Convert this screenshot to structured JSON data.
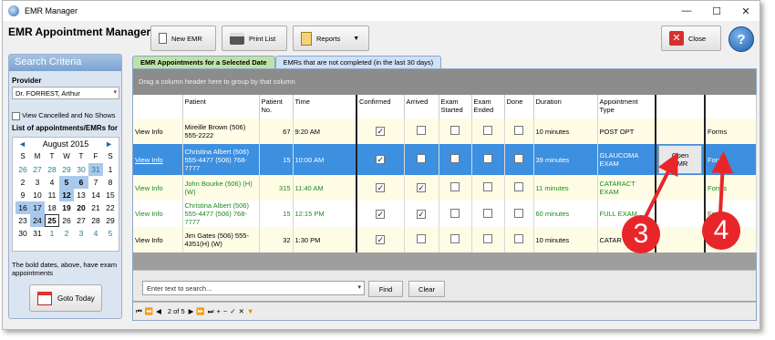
{
  "window": {
    "title": "EMR Manager",
    "minimize": "—",
    "maximize": "☐",
    "close": "✕"
  },
  "app_title": "EMR Appointment Manager",
  "toolbar": {
    "new_emr": "New EMR",
    "print_list": "Print List",
    "reports": "Reports",
    "close": "Close",
    "help": "?"
  },
  "search": {
    "title": "Search Criteria",
    "provider_label": "Provider",
    "provider_value": "Dr. FORREST, Arthur",
    "view_cancelled": "View Cancelled and No Shows",
    "list_label": "List of appointments/EMRs for",
    "month": "August 2015",
    "prev": "◄",
    "next": "►",
    "dow": [
      "S",
      "M",
      "T",
      "W",
      "T",
      "F",
      "S"
    ],
    "days": [
      "26",
      "27",
      "28",
      "29",
      "30",
      "31",
      "1",
      "2",
      "3",
      "4",
      "5",
      "6",
      "7",
      "8",
      "9",
      "10",
      "11",
      "12",
      "13",
      "14",
      "15",
      "16",
      "17",
      "18",
      "19",
      "20",
      "21",
      "22",
      "23",
      "24",
      "25",
      "26",
      "27",
      "28",
      "29",
      "30",
      "31",
      "1",
      "2",
      "3",
      "4",
      "5"
    ],
    "note": "The bold dates, above, have exam appointments",
    "goto_today": "Goto Today"
  },
  "tabs": {
    "selected_date": "EMR Appointments for a Selected Date",
    "not_completed": "EMRs that are not completed (in the last 30 days)"
  },
  "grid": {
    "group_hint": "Drag a column header here to group by that column",
    "headers": {
      "patient": "Patient",
      "patient_no": "Patient No.",
      "time": "Time",
      "confirmed": "Confirmed",
      "arrived": "Arrived",
      "exam_started": "Exam Started",
      "exam_ended": "Exam Ended",
      "done": "Done",
      "duration": "Duration",
      "appointment_type": "Appointment Type"
    },
    "rows": [
      {
        "view": "View Info",
        "patient": "Mireille Brown  (506) 555-2222",
        "no": "67",
        "time": "9:20 AM",
        "confirmed": true,
        "arrived": false,
        "duration": "10 minutes",
        "type": "POST OPT",
        "open": "",
        "forms": "Forms"
      },
      {
        "view": "View Info",
        "patient": "Christina Albert (506) 555-4477 (506) 768-7777",
        "no": "15",
        "time": "10:00 AM",
        "confirmed": true,
        "arrived": false,
        "duration": "39 minutes",
        "type": "GLAUCOMA EXAM",
        "open": "Open EMR",
        "forms": "Forms"
      },
      {
        "view": "View Info",
        "patient": "John Bourke  (506) (H) (W)",
        "no": "315",
        "time": "11:40 AM",
        "confirmed": true,
        "arrived": true,
        "duration": "11 minutes",
        "type": "CATARACT EXAM",
        "open": "",
        "forms": "Forms"
      },
      {
        "view": "View Info",
        "patient": "Christina Albert  (506) 555-4477  (506) 768-7777",
        "no": "15",
        "time": "12:15 PM",
        "confirmed": true,
        "arrived": true,
        "duration": "60 minutes",
        "type": "FULL EXAM",
        "open": "",
        "forms": "Forms"
      },
      {
        "view": "View Info",
        "patient": "Jim Gates  (506) 555-4351(H)  (W)",
        "no": "32",
        "time": "1:30 PM",
        "confirmed": true,
        "arrived": false,
        "duration": "10 minutes",
        "type": "CATAR",
        "open": "",
        "forms": ""
      }
    ]
  },
  "find": {
    "placeholder": "Enter text to search...",
    "find": "Find",
    "clear": "Clear"
  },
  "pager": {
    "page": "2 of 5"
  },
  "callouts": {
    "a": "3",
    "b": "4"
  }
}
